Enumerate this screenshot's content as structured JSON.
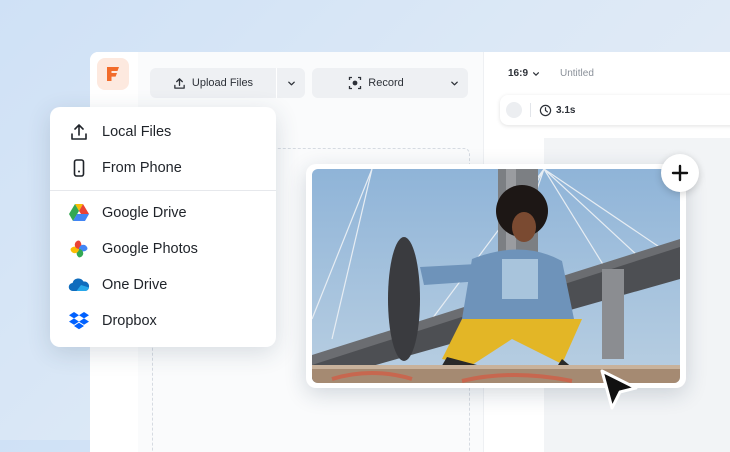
{
  "toolbar": {
    "upload_label": "Upload Files",
    "record_label": "Record"
  },
  "editor": {
    "aspect_ratio": "16:9",
    "project_title": "Untitled",
    "duration": "3.1s"
  },
  "upload_menu": {
    "items": [
      {
        "label": "Local Files",
        "icon": "upload-icon"
      },
      {
        "label": "From Phone",
        "icon": "phone-icon"
      },
      {
        "label": "Google Drive",
        "icon": "google-drive-icon"
      },
      {
        "label": "Google Photos",
        "icon": "google-photos-icon"
      },
      {
        "label": "One Drive",
        "icon": "onedrive-icon"
      },
      {
        "label": "Dropbox",
        "icon": "dropbox-icon"
      }
    ]
  },
  "colors": {
    "brand": "#f26b2a",
    "google_blue": "#4285f4",
    "google_green": "#34a853",
    "google_yellow": "#fbbc04",
    "google_red": "#ea4335",
    "onedrive": "#0f6cbd",
    "dropbox": "#0061ff"
  }
}
